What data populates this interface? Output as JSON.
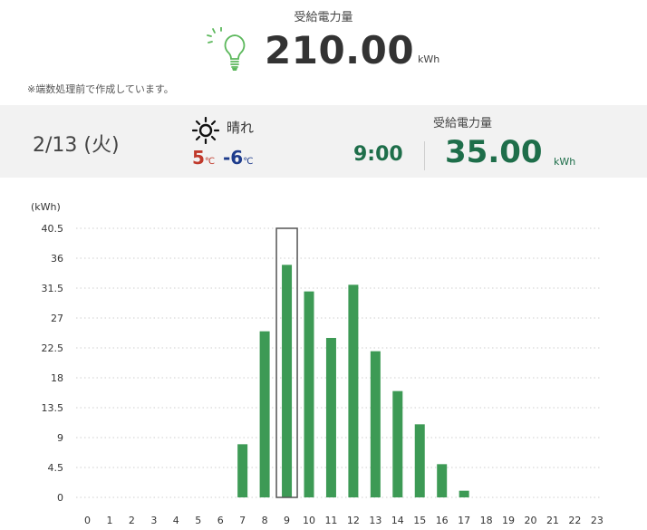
{
  "summary": {
    "label": "受給電力量",
    "total": "210.00",
    "unit": "kWh",
    "note": "※端数処理前で作成しています。",
    "icon": "lightbulb-icon"
  },
  "day": {
    "date": "2/13 (火)",
    "weather_icon": "sun-icon",
    "weather": "晴れ",
    "temp_high": "5",
    "temp_low": "-6",
    "temp_unit": "℃",
    "label": "受給電力量",
    "time": "9:00",
    "value": "35.00",
    "unit": "kWh"
  },
  "colors": {
    "bar": "#3d9a55",
    "accent_green": "#1e6e4a",
    "temp_high": "#c0392b",
    "temp_low": "#1e3c8c"
  },
  "chart_data": {
    "type": "bar",
    "ylabel": "(kWh)",
    "ylim": [
      0,
      40.5
    ],
    "y_ticks": [
      "0",
      "4.5",
      "9",
      "13.5",
      "18",
      "22.5",
      "27",
      "31.5",
      "36",
      "40.5"
    ],
    "categories": [
      "0",
      "1",
      "2",
      "3",
      "4",
      "5",
      "6",
      "7",
      "8",
      "9",
      "10",
      "11",
      "12",
      "13",
      "14",
      "15",
      "16",
      "17",
      "18",
      "19",
      "20",
      "21",
      "22",
      "23"
    ],
    "values": [
      0,
      0,
      0,
      0,
      0,
      0,
      0,
      8,
      25,
      35,
      31,
      24,
      32,
      22,
      16,
      11,
      5,
      1,
      0,
      0,
      0,
      0,
      0,
      0
    ],
    "selected_category": "9",
    "grid": true
  }
}
